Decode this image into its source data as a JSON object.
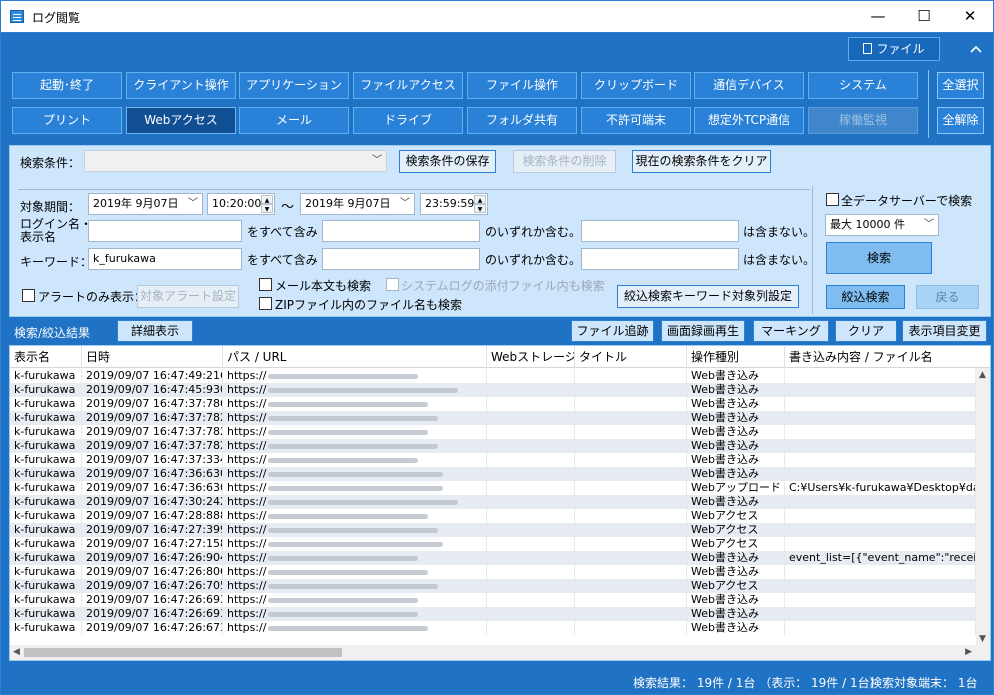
{
  "window": {
    "title": "ログ閲覧",
    "minimize": "—",
    "maximize": "☐",
    "close": "✕"
  },
  "topbar": {
    "file_label": "ファイル",
    "collapse_glyph": "︿"
  },
  "categories": {
    "row1": [
      "起動･終了",
      "クライアント操作",
      "アプリケーション",
      "ファイルアクセス",
      "ファイル操作",
      "クリップボード",
      "通信デバイス",
      "システム"
    ],
    "row2": [
      "プリント",
      "Webアクセス",
      "メール",
      "ドライブ",
      "フォルダ共有",
      "不許可端末",
      "想定外TCP通信",
      "稼働監視"
    ],
    "select_all": "全選択",
    "deselect_all": "全解除"
  },
  "search": {
    "condition_label": "検索条件：",
    "condition_value": "",
    "save_condition": "検索条件の保存",
    "delete_condition": "検索条件の削除",
    "clear_condition": "現在の検索条件をクリア",
    "period_label": "対象期間：",
    "start_date": "2019年  9月07日",
    "start_time": "10:20:00",
    "tilde": "〜",
    "end_date": "2019年  9月07日",
    "end_time": "23:59:59",
    "login_label_1": "ログイン名・",
    "login_label_2": "表示名",
    "keyword_label": "キーワード：",
    "keyword_value": "k_furukawa",
    "contains_all": "をすべて含み",
    "contains_any": "のいずれか含む。",
    "not_contains": "は含まない。",
    "alert_only": "アラートのみ表示：",
    "alert_settings": "対象アラート設定",
    "mail_body": "メール本文も検索",
    "syslog_attach": "システムログの添付ファイル内も検索",
    "zip_names": "ZIPファイル内のファイル名も検索",
    "keyword_columns": "絞込検索キーワード対象列設定",
    "all_servers": "全データサーバーで検索",
    "max_count": "最大 10000 件",
    "search_btn": "検索",
    "refine_btn": "絞込検索",
    "back_btn": "戻る"
  },
  "results": {
    "title": "検索/絞込結果",
    "detail_btn": "詳細表示",
    "file_trace": "ファイル追跡",
    "screen_replay": "画面録画再生",
    "marking": "マーキング",
    "clear": "クリア",
    "display_items": "表示項目変更",
    "columns": [
      "表示名",
      "日時",
      "パス / URL",
      "Webストレージ...",
      "タイトル",
      "操作種別",
      "書き込み内容 / ファイル名"
    ],
    "rows": [
      {
        "name": "k-furukawa",
        "time": "2019/09/07 16:47:49:216",
        "url": "https://",
        "op": "Web書き込み",
        "content": ""
      },
      {
        "name": "k-furukawa",
        "time": "2019/09/07 16:47:45:930",
        "url": "https://",
        "op": "Web書き込み",
        "content": ""
      },
      {
        "name": "k-furukawa",
        "time": "2019/09/07 16:47:37:786",
        "url": "https://",
        "op": "Web書き込み",
        "content": ""
      },
      {
        "name": "k-furukawa",
        "time": "2019/09/07 16:47:37:782",
        "url": "https://",
        "op": "Web書き込み",
        "content": ""
      },
      {
        "name": "k-furukawa",
        "time": "2019/09/07 16:47:37:782",
        "url": "https://",
        "op": "Web書き込み",
        "content": ""
      },
      {
        "name": "k-furukawa",
        "time": "2019/09/07 16:47:37:782",
        "url": "https://",
        "op": "Web書き込み",
        "content": ""
      },
      {
        "name": "k-furukawa",
        "time": "2019/09/07 16:47:37:334",
        "url": "https://",
        "op": "Web書き込み",
        "content": ""
      },
      {
        "name": "k-furukawa",
        "time": "2019/09/07 16:47:36:630",
        "url": "https://",
        "op": "Web書き込み",
        "content": ""
      },
      {
        "name": "k-furukawa",
        "time": "2019/09/07 16:47:36:630",
        "url": "https://",
        "op": "Webアップロード",
        "content": "C:¥Users¥k-furukawa¥Desktop¥data"
      },
      {
        "name": "k-furukawa",
        "time": "2019/09/07 16:47:30:242",
        "url": "https://",
        "op": "Web書き込み",
        "content": ""
      },
      {
        "name": "k-furukawa",
        "time": "2019/09/07 16:47:28:888",
        "url": "https://",
        "op": "Webアクセス",
        "content": ""
      },
      {
        "name": "k-furukawa",
        "time": "2019/09/07 16:47:27:399",
        "url": "https://",
        "op": "Webアクセス",
        "content": ""
      },
      {
        "name": "k-furukawa",
        "time": "2019/09/07 16:47:27:158",
        "url": "https://",
        "op": "Webアクセス",
        "content": ""
      },
      {
        "name": "k-furukawa",
        "time": "2019/09/07 16:47:26:904",
        "url": "https://",
        "op": "Web書き込み",
        "content": "event_list=[{\"event_name\":\"receive\","
      },
      {
        "name": "k-furukawa",
        "time": "2019/09/07 16:47:26:806",
        "url": "https://",
        "op": "Web書き込み",
        "content": ""
      },
      {
        "name": "k-furukawa",
        "time": "2019/09/07 16:47:26:705",
        "url": "https://",
        "op": "Webアクセス",
        "content": ""
      },
      {
        "name": "k-furukawa",
        "time": "2019/09/07 16:47:26:693",
        "url": "https://",
        "op": "Web書き込み",
        "content": ""
      },
      {
        "name": "k-furukawa",
        "time": "2019/09/07 16:47:26:693",
        "url": "https://",
        "op": "Web書き込み",
        "content": ""
      },
      {
        "name": "k-furukawa",
        "time": "2019/09/07 16:47:26:673",
        "url": "https://",
        "op": "Web書き込み",
        "content": ""
      }
    ]
  },
  "status": {
    "summary": "検索結果： 19件 / 1台 （表示： 19件 / 1台）",
    "terminals": "検索対象端末：  1台"
  }
}
